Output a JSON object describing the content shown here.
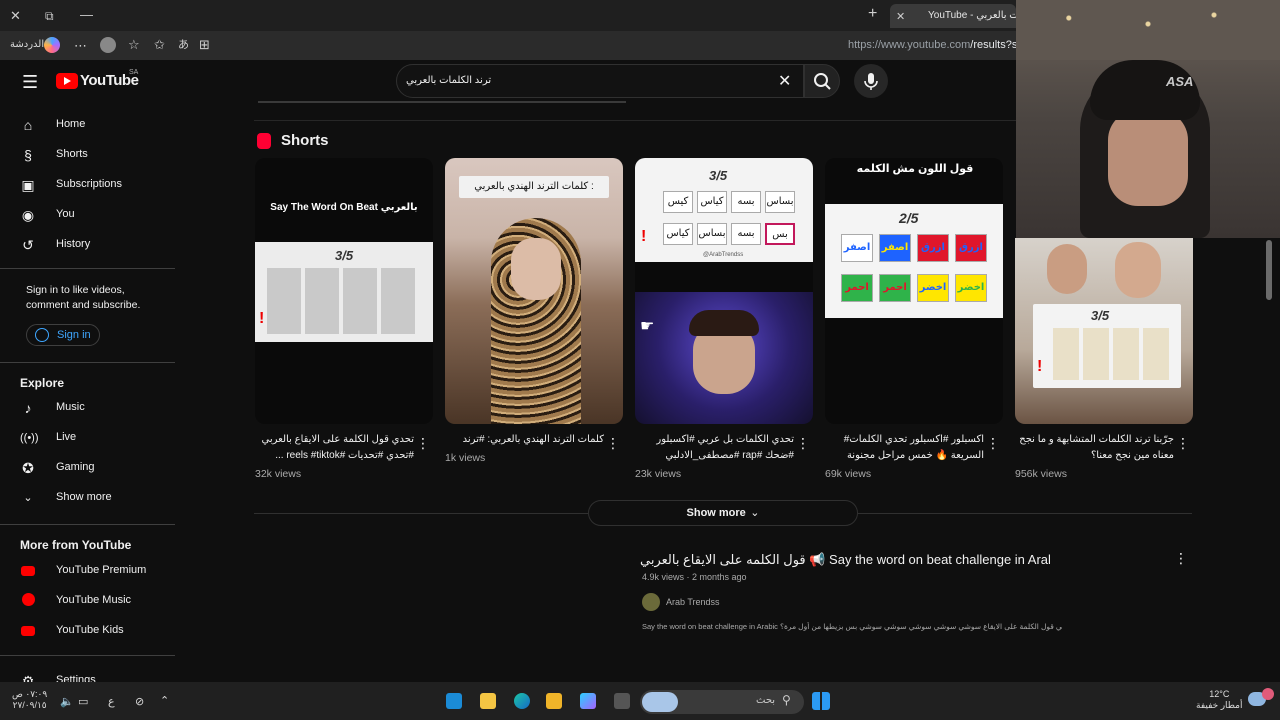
{
  "browser": {
    "tab_title": "YouTube - ترند الكلمات بالعربي",
    "url_host": "https://www.youtube.com",
    "url_path": "/results?se",
    "sidebar_label": "الدردشة"
  },
  "header": {
    "logo_text": "YouTube",
    "logo_region": "SA",
    "search_query": "ترند الكلمات بالعربي"
  },
  "sidebar": {
    "main": [
      {
        "label": "Home",
        "icon": "home-icon"
      },
      {
        "label": "Shorts",
        "icon": "shorts-icon"
      },
      {
        "label": "Subscriptions",
        "icon": "subscriptions-icon"
      },
      {
        "label": "You",
        "icon": "you-icon"
      },
      {
        "label": "History",
        "icon": "history-icon"
      }
    ],
    "signin_prompt": "Sign in to like videos, comment and subscribe.",
    "signin_button": "Sign in",
    "explore_title": "Explore",
    "explore": [
      {
        "label": "Music",
        "icon": "music-icon"
      },
      {
        "label": "Live",
        "icon": "live-icon"
      },
      {
        "label": "Gaming",
        "icon": "gaming-icon"
      },
      {
        "label": "Show more",
        "icon": "chevron-down-icon"
      }
    ],
    "more_title": "More from YouTube",
    "more": [
      {
        "label": "YouTube Premium"
      },
      {
        "label": "YouTube Music"
      },
      {
        "label": "YouTube Kids"
      }
    ],
    "settings": "Settings"
  },
  "shorts": {
    "title": "Shorts",
    "items": [
      {
        "title": "تحدي قول الكلمة على الايقاع بالعربي #تحدي #تحديات #reels #tiktok ...",
        "views": "32k views",
        "thumb_text": "Say The Word On Beat بالعربي",
        "score": "3/5"
      },
      {
        "title": "كلمات الترند الهندي بالعربي: #ترند",
        "views": "1k views",
        "thumb_text": "كلمات الترند الهندي بالعربي :"
      },
      {
        "title": "تحدي الكلمات بل عربي #اكسبلور #ضحك #rap #مصطفى_الادلبي",
        "views": "23k views",
        "score": "3/5",
        "watermark": "@ArabTrendss"
      },
      {
        "title": "اكسبلور #اكسبلور تحدي الكلمات# السريعة 🔥 خمس مراحل مجنونة",
        "views": "69k views",
        "thumb_text": "قول اللون مش الكلمه",
        "score": "2/5"
      },
      {
        "title": "جرّبنا ترند الكلمات المتشابهة و ما نجح معناه مين نجح معنا؟",
        "views": "956k views",
        "score": "3/5"
      }
    ],
    "show_more": "Show more"
  },
  "thumb_words": {
    "card3": [
      "بساس",
      "بسه",
      "كياس",
      "كيس",
      "بس",
      "بسه",
      "بساس",
      "كياس"
    ],
    "card4": [
      "ازرق",
      "ازرق",
      "اصفر",
      "اصفر",
      "اخضر",
      "اخضر",
      "احمر",
      "احمر"
    ]
  },
  "video": {
    "title": "قول الكلمه على الايقاع بالعربي 📢 Say the word on beat challenge in Arabic",
    "meta": "4.9k views · 2 months ago",
    "channel": "Arab Trendss",
    "description": "Say the word on beat challenge in Arabic بالعربي قول الكلمة على الايقاع سوشي سوشي سوشي سوشي سوشي بس بزيطها من أول مرة؟ ..."
  },
  "webcam": {
    "overlay_text": "ASA"
  },
  "taskbar": {
    "time": "٠٧:٠٩ ص",
    "date": "٢٧/٠٩/١٥",
    "lang": "ع",
    "search": "بحث",
    "weather_temp": "12°C",
    "weather_desc": "أمطار خفيفة"
  },
  "colors": {
    "accent": "#ff0000",
    "signin_blue": "#3ea6ff",
    "bg": "#0f0f0f"
  }
}
